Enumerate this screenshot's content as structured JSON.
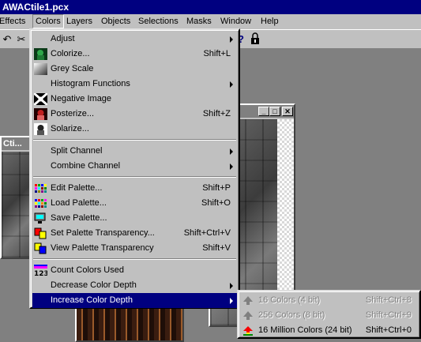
{
  "window": {
    "title": "AWACtile1.pcx"
  },
  "menubar": [
    {
      "label": "Effects",
      "active": false
    },
    {
      "label": "Colors",
      "active": true
    },
    {
      "label": "Layers",
      "active": false
    },
    {
      "label": "Objects",
      "active": false
    },
    {
      "label": "Selections",
      "active": false
    },
    {
      "label": "Masks",
      "active": false
    },
    {
      "label": "Window",
      "active": false
    },
    {
      "label": "Help",
      "active": false
    }
  ],
  "background_windows": {
    "left_title": "Cti..."
  },
  "colors_menu": {
    "items": [
      {
        "label": "Adjust",
        "shortcut": "",
        "submenu": true,
        "icon": "none"
      },
      {
        "label": "Colorize...",
        "shortcut": "Shift+L",
        "submenu": false,
        "icon": "colorize-icon"
      },
      {
        "label": "Grey Scale",
        "shortcut": "",
        "submenu": false,
        "icon": "grey-scale-icon"
      },
      {
        "label": "Histogram Functions",
        "shortcut": "",
        "submenu": true,
        "icon": "none"
      },
      {
        "label": "Negative Image",
        "shortcut": "",
        "submenu": false,
        "icon": "negative-image-icon"
      },
      {
        "label": "Posterize...",
        "shortcut": "Shift+Z",
        "submenu": false,
        "icon": "posterize-icon"
      },
      {
        "label": "Solarize...",
        "shortcut": "",
        "submenu": false,
        "icon": "solarize-icon"
      },
      {
        "label": "Split Channel",
        "shortcut": "",
        "submenu": true,
        "icon": "none"
      },
      {
        "label": "Combine Channel",
        "shortcut": "",
        "submenu": true,
        "icon": "none"
      },
      {
        "label": "Edit Palette...",
        "shortcut": "Shift+P",
        "submenu": false,
        "icon": "edit-palette-icon"
      },
      {
        "label": "Load Palette...",
        "shortcut": "Shift+O",
        "submenu": false,
        "icon": "load-palette-icon"
      },
      {
        "label": "Save Palette...",
        "shortcut": "",
        "submenu": false,
        "icon": "save-palette-icon"
      },
      {
        "label": "Set Palette Transparency...",
        "shortcut": "Shift+Ctrl+V",
        "submenu": false,
        "icon": "set-transparency-icon"
      },
      {
        "label": "View Palette Transparency",
        "shortcut": "Shift+V",
        "submenu": false,
        "icon": "view-transparency-icon"
      },
      {
        "label": "Count Colors Used",
        "shortcut": "",
        "submenu": false,
        "icon": "count-colors-icon"
      },
      {
        "label": "Decrease Color Depth",
        "shortcut": "",
        "submenu": true,
        "icon": "none"
      },
      {
        "label": "Increase Color Depth",
        "shortcut": "",
        "submenu": true,
        "icon": "none",
        "highlighted": true
      }
    ]
  },
  "increase_depth_submenu": {
    "items": [
      {
        "label": "16 Colors (4 bit)",
        "shortcut": "Shift+Ctrl+8",
        "enabled": false
      },
      {
        "label": "256 Colors (8 bit)",
        "shortcut": "Shift+Ctrl+9",
        "enabled": false
      },
      {
        "label": "16 Million Colors (24 bit)",
        "shortcut": "Shift+Ctrl+0",
        "enabled": true
      }
    ]
  }
}
